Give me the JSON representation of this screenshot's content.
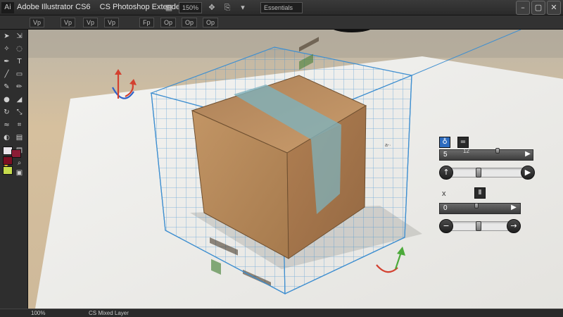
{
  "titlebar": {
    "app_title": "Adobe Illustrator CS6",
    "doc_title": "CS Photoshop Extended",
    "zoom": "150%",
    "mode": "Essentials"
  },
  "optionsbar": {
    "buttons": [
      "Vp",
      "Vp",
      "Vp",
      "Vp",
      "Fp",
      "Op",
      "Op",
      "Op"
    ]
  },
  "statusbar": {
    "zoom": "100%",
    "doc_info": "CS Mixed Layer"
  },
  "panel_1": {
    "value_label": "5",
    "mid_label": "12"
  },
  "panel_2": {
    "value_label": "0",
    "close_label": "x"
  },
  "colors": {
    "grid_blue": "#3f8fd0",
    "box_cardboard": "#b98a5c",
    "tape_blue": "#7fb1bb",
    "arrow_red": "#d3402f",
    "arrow_green": "#4caa3a",
    "arrow_blue": "#2f62c8"
  },
  "icons": {
    "rotate_gizmo_top": "rotate-arrows-icon",
    "rotate_gizmo_bottom": "rotate-arrows-icon"
  }
}
